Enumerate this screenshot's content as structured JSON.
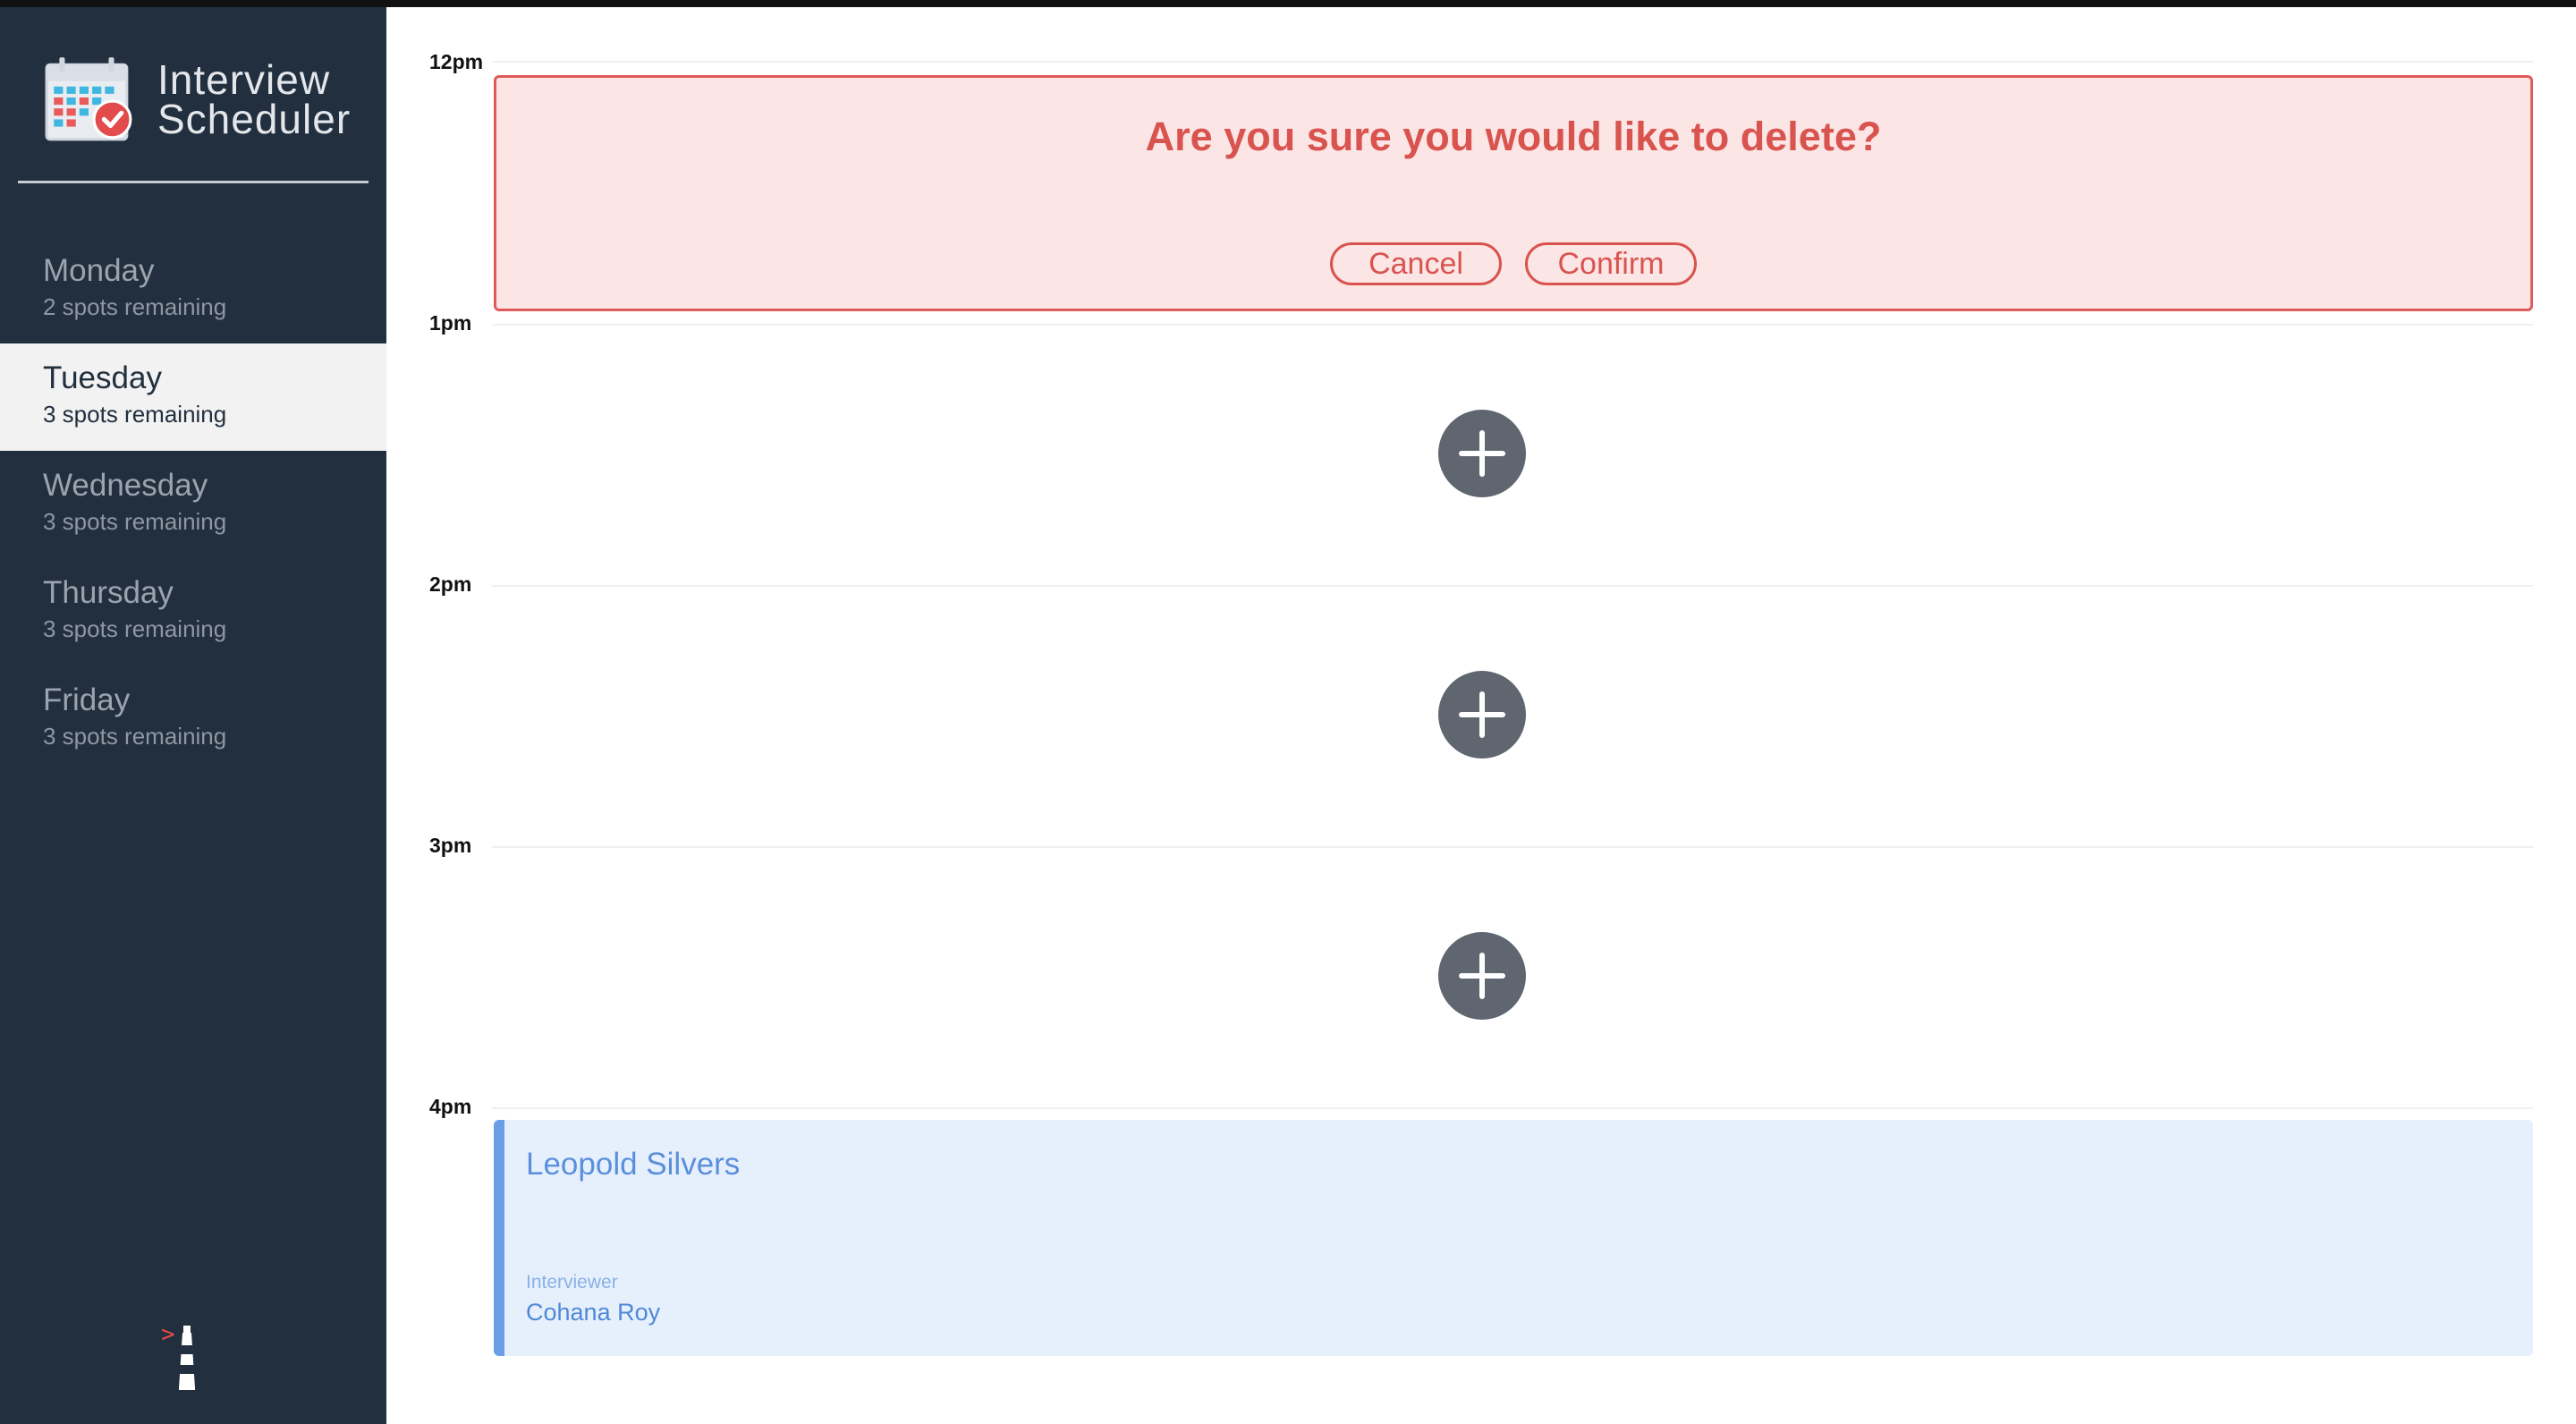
{
  "app": {
    "title_line1": "Interview",
    "title_line2": "Scheduler"
  },
  "sidebar": {
    "days": [
      {
        "name": "Monday",
        "spots": "2 spots remaining",
        "selected": false
      },
      {
        "name": "Tuesday",
        "spots": "3 spots remaining",
        "selected": true
      },
      {
        "name": "Wednesday",
        "spots": "3 spots remaining",
        "selected": false
      },
      {
        "name": "Thursday",
        "spots": "3 spots remaining",
        "selected": false
      },
      {
        "name": "Friday",
        "spots": "3 spots remaining",
        "selected": false
      }
    ]
  },
  "schedule": {
    "times": [
      "12pm",
      "1pm",
      "2pm",
      "3pm",
      "4pm"
    ],
    "confirm": {
      "message": "Are you sure you would like to delete?",
      "cancel_label": "Cancel",
      "confirm_label": "Confirm"
    },
    "appointment": {
      "student": "Leopold Silvers",
      "interviewer_label": "Interviewer",
      "interviewer": "Cohana Roy"
    }
  },
  "colors": {
    "sidebar_bg": "#222f3e",
    "selected_bg": "#f2f2f2",
    "danger": "#d9534f",
    "danger_bg": "#fbe5e5",
    "appointment_bg": "#e6f0fd",
    "appointment_accent": "#6a9ee6",
    "add_button": "#5f6670"
  },
  "icons": {
    "logo": "calendar-check-icon",
    "add": "plus-circle-icon",
    "footer": "lighthouse-icon"
  }
}
